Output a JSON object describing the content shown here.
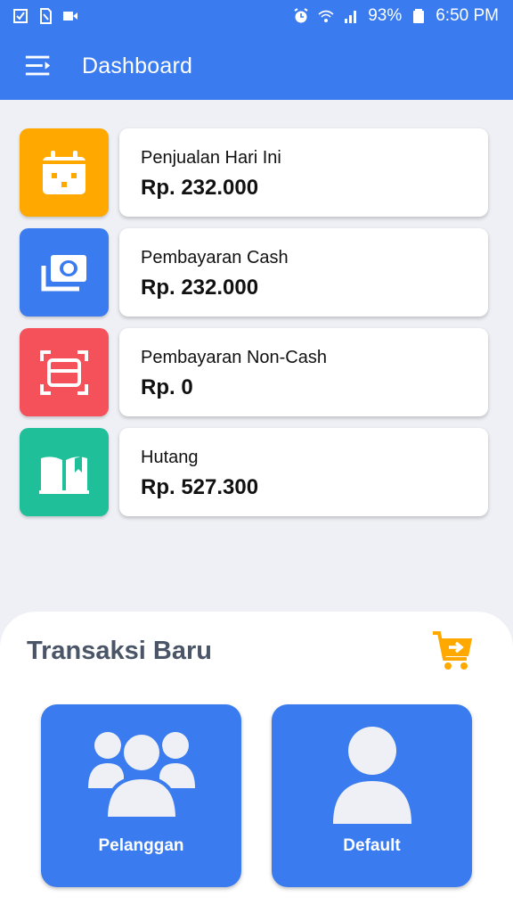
{
  "status_bar": {
    "battery": "93%",
    "time": "6:50 PM",
    "left_icons": [
      "checkbox-icon",
      "sim-icon",
      "video-icon"
    ],
    "right_icons": [
      "alarm-icon",
      "wifi-icon",
      "signal-icon",
      "battery-icon"
    ]
  },
  "appbar": {
    "title": "Dashboard",
    "menu_icon": "menu-icon"
  },
  "cards": [
    {
      "label": "Penjualan Hari Ini",
      "value": "Rp. 232.000",
      "icon": "calendar-icon",
      "color": "#FFA800"
    },
    {
      "label": "Pembayaran Cash",
      "value": "Rp. 232.000",
      "icon": "cash-icon",
      "color": "#3A7BF0"
    },
    {
      "label": "Pembayaran Non-Cash",
      "value": "Rp. 0",
      "icon": "card-scan-icon",
      "color": "#F5515B"
    },
    {
      "label": "Hutang",
      "value": "Rp. 527.300",
      "icon": "book-icon",
      "color": "#1FBF9A"
    }
  ],
  "new_transaction": {
    "title": "Transaksi Baru",
    "cart_icon": "cart-arrow-icon",
    "accent": "#FFA800",
    "buttons": [
      {
        "label": "Pelanggan",
        "icon": "customers-icon"
      },
      {
        "label": "Default",
        "icon": "user-icon"
      }
    ]
  },
  "colors": {
    "primary": "#3A7BF0",
    "background": "#EEF0F5"
  }
}
